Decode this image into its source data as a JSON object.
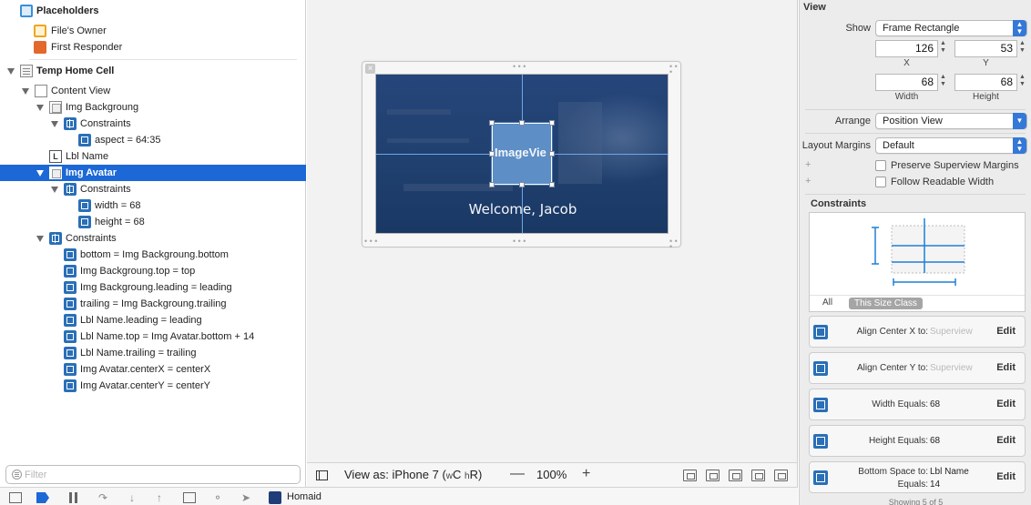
{
  "outline": {
    "rows": [
      {
        "label": "Placeholders",
        "icon": "cube-icon-blue"
      },
      {
        "label": "File's Owner",
        "icon": "cube-icon"
      },
      {
        "label": "First Responder",
        "icon": "first-responder-icon"
      },
      {
        "label": "Temp Home Cell",
        "icon": "table-cell-icon"
      },
      {
        "label": "Content View",
        "icon": "view-icon"
      },
      {
        "label": "Img Backgroung",
        "icon": "image-view-icon"
      },
      {
        "label": "Constraints",
        "icon": "constraints-icon"
      },
      {
        "label": "aspect = 64:35",
        "icon": "constraint-icon"
      },
      {
        "label": "Lbl Name",
        "icon": "label-icon"
      },
      {
        "label": "Img Avatar",
        "icon": "image-view-icon"
      },
      {
        "label": "Constraints",
        "icon": "constraints-icon"
      },
      {
        "label": "width = 68",
        "icon": "constraint-icon"
      },
      {
        "label": "height = 68",
        "icon": "constraint-icon"
      },
      {
        "label": "Constraints",
        "icon": "constraints-icon"
      },
      {
        "label": "bottom = Img Backgroung.bottom",
        "icon": "constraint-icon"
      },
      {
        "label": "Img Backgroung.top = top",
        "icon": "constraint-icon"
      },
      {
        "label": "Img Backgroung.leading = leading",
        "icon": "constraint-icon"
      },
      {
        "label": "trailing = Img Backgroung.trailing",
        "icon": "constraint-icon"
      },
      {
        "label": "Lbl Name.leading = leading",
        "icon": "constraint-icon"
      },
      {
        "label": "Lbl Name.top = Img Avatar.bottom + 14",
        "icon": "constraint-icon"
      },
      {
        "label": "Lbl Name.trailing = trailing",
        "icon": "constraint-icon"
      },
      {
        "label": "Img Avatar.centerX = centerX",
        "icon": "constraint-icon"
      },
      {
        "label": "Img Avatar.centerY = centerY",
        "icon": "constraint-icon"
      }
    ],
    "selected_label": "Img Avatar",
    "filter_placeholder": "Filter"
  },
  "canvas": {
    "avatar_text": "ImageVie",
    "welcome_text": "Welcome, Jacob",
    "close_glyph": "×",
    "dots_glyph": "• • •"
  },
  "canvas_bar": {
    "view_as_prefix": "View as: iPhone 7 (",
    "w_prefix": "w",
    "w_class": "C",
    "h_prefix": "h",
    "h_class": "R",
    "view_as_suffix": ")",
    "zoom_minus": "—",
    "zoom": "100%",
    "zoom_plus": "+"
  },
  "debug_bar": {
    "project": "Homaid",
    "project_icon_text": "Homaid"
  },
  "inspector": {
    "section_title": "View",
    "show_label": "Show",
    "show_value": "Frame Rectangle",
    "x": "126",
    "y": "53",
    "width": "68",
    "height": "68",
    "x_label": "X",
    "y_label": "Y",
    "width_label": "Width",
    "height_label": "Height",
    "arrange_label": "Arrange",
    "arrange_value": "Position View",
    "margins_label": "Layout Margins",
    "margins_value": "Default",
    "preserve_label": "Preserve Superview Margins",
    "follow_label": "Follow Readable Width",
    "constraints_title": "Constraints",
    "tab_all": "All",
    "tab_size_class": "This Size Class",
    "plus": "+",
    "edit": "Edit",
    "rows": [
      {
        "title": "Align Center X to:",
        "value": "Superview",
        "placeholder": true
      },
      {
        "title": "Align Center Y to:",
        "value": "Superview",
        "placeholder": true
      },
      {
        "title": "Width Equals:",
        "value": "68",
        "placeholder": false
      },
      {
        "title": "Height Equals:",
        "value": "68",
        "placeholder": false
      },
      {
        "title": "Bottom Space to:",
        "value": "Lbl Name",
        "title2": "Equals:",
        "value2": "14"
      }
    ],
    "showing": "Showing 5 of 5"
  },
  "colors": {
    "selection": "#1c68d6",
    "canvas_bg": "#f2f2f2",
    "image_bg": "#20406f",
    "avatar": "#5d8ec6",
    "guide": "#6aa9e8",
    "popup_arrow": "#3478d8"
  }
}
